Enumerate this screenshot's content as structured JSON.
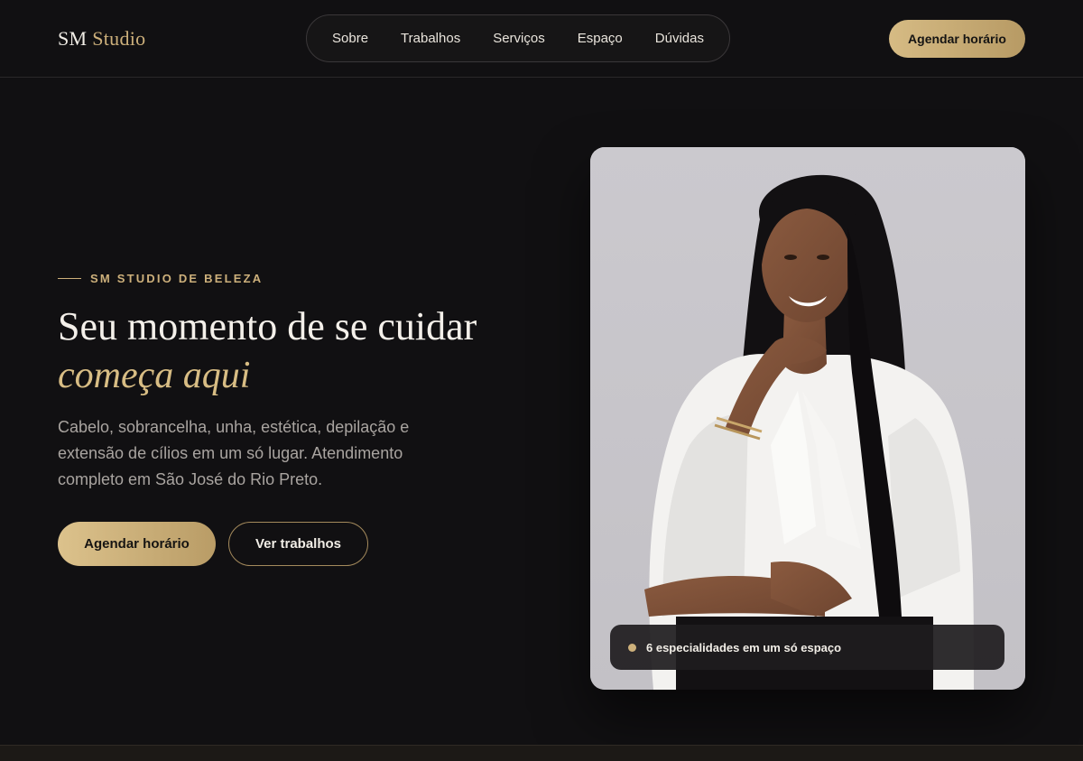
{
  "header": {
    "logo_main": "SM",
    "logo_accent": "Studio",
    "nav": [
      "Sobre",
      "Trabalhos",
      "Serviços",
      "Espaço",
      "Dúvidas"
    ],
    "cta_label": "Agendar horário"
  },
  "hero": {
    "eyebrow": "SM STUDIO DE BELEZA",
    "headline": "Seu momento de se cuidar",
    "headline_accent": "começa aqui",
    "subtitle": "Cabelo, sobrancelha, unha, estética, depilação e extensão de cílios em um só lugar. Atendimento completo em São José do Rio Preto.",
    "primary_button": "Agendar horário",
    "secondary_button": "Ver trabalhos",
    "badge_text": "6 especialidades em um só espaço"
  },
  "colors": {
    "background": "#111012",
    "accent_gold": "#cdb07b",
    "text": "#f1ede6"
  }
}
